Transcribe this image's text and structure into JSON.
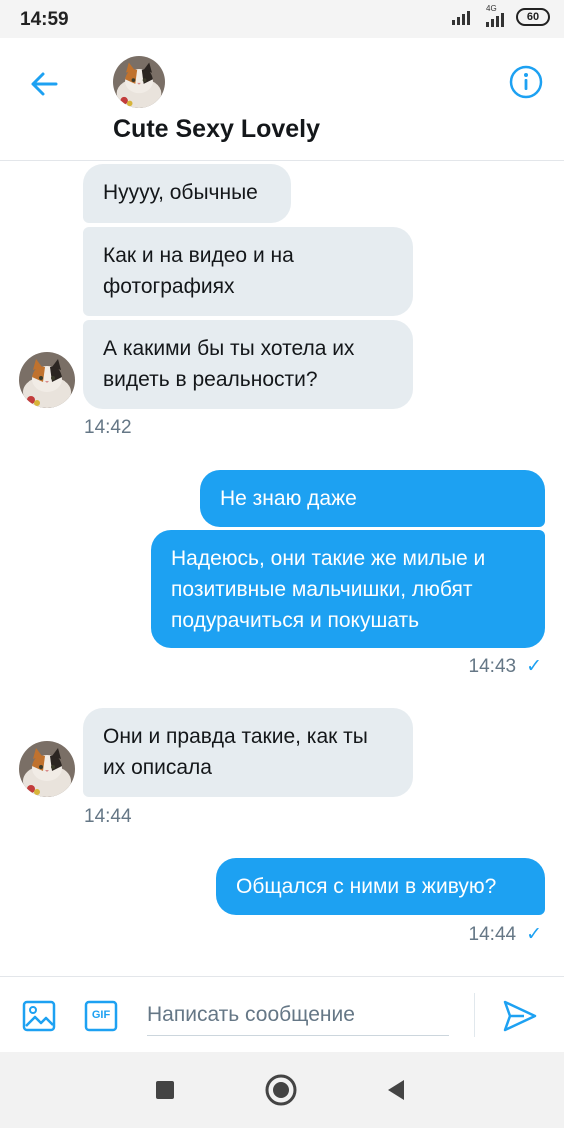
{
  "status": {
    "time": "14:59",
    "network": "4G",
    "battery": "60"
  },
  "header": {
    "title": "Cute Sexy Lovely"
  },
  "messages": [
    {
      "text": "Нуууу, обычные"
    },
    {
      "text": "Как и на видео и на фотографиях"
    },
    {
      "text": "А какими бы ты хотела их видеть в реальности?"
    },
    {
      "time": "14:42"
    },
    {
      "text": "Не знаю даже"
    },
    {
      "text": "Надеюсь, они такие же милые и позитивные мальчишки, любят подурачиться и покушать"
    },
    {
      "time": "14:43",
      "check": "✓"
    },
    {
      "text": "Они и правда такие, как ты их описала"
    },
    {
      "time": "14:44"
    },
    {
      "text": "Общался с ними в живую?"
    },
    {
      "time": "14:44",
      "check": "✓"
    }
  ],
  "composer": {
    "placeholder": "Написать сообщение",
    "gif_label": "GIF"
  },
  "colors": {
    "accent": "#1da1f2",
    "incoming_bubble": "#e6ecf0",
    "text": "#14171a",
    "muted": "#657786"
  },
  "icons": [
    "back-arrow-icon",
    "info-icon",
    "image-icon",
    "gif-icon",
    "send-icon",
    "stop-square-icon",
    "home-circle-icon",
    "back-triangle-icon"
  ]
}
